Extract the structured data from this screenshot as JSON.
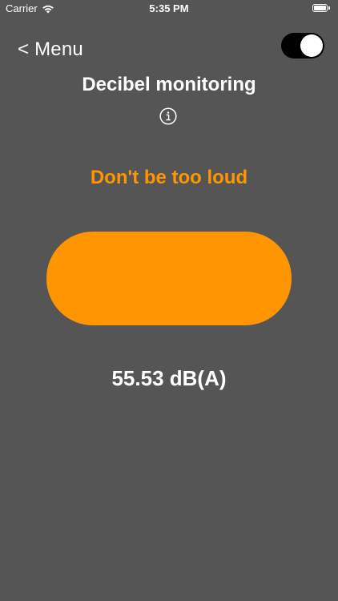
{
  "status_bar": {
    "carrier": "Carrier",
    "time": "5:35 PM",
    "wifi_icon": "wifi-icon",
    "battery_icon": "battery-icon",
    "battery_level": 1.0
  },
  "header": {
    "menu_label": "< Menu",
    "title": "Decibel monitoring",
    "info_icon": "info-icon",
    "toggle": {
      "on": true,
      "track_color": "#000000",
      "knob_color": "#ffffff"
    }
  },
  "monitor": {
    "warning": "Don't be too loud",
    "indicator_color": "#ff9500",
    "reading": "55.53 dB(A)"
  },
  "colors": {
    "background": "#555555",
    "accent": "#ff9500",
    "text": "#ffffff"
  }
}
